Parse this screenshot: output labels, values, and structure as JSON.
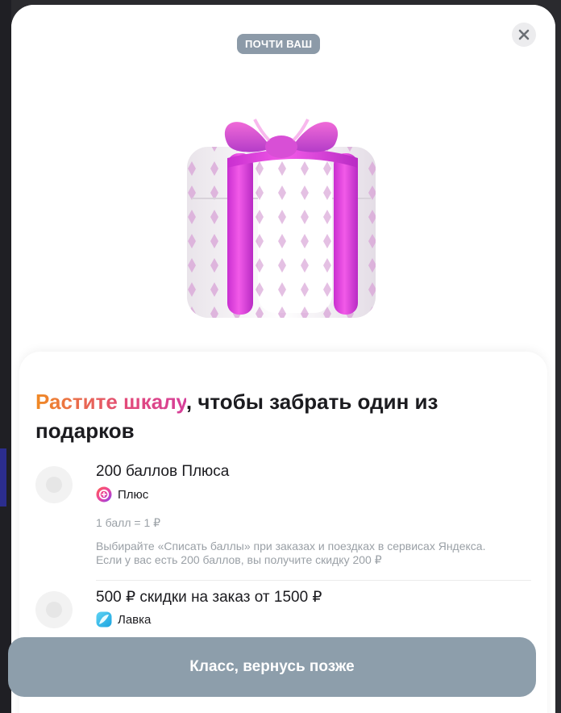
{
  "badge": "ПОЧТИ ВАШ",
  "icons": {
    "close": "close-icon",
    "gift": "gift-image",
    "plus": "plus-logo-icon",
    "lavka": "lavka-logo-icon"
  },
  "colors": {
    "badge_bg": "#8c9aa8",
    "accent_gradient_start": "#f08a24",
    "accent_gradient_end": "#d63f9a",
    "button_bg": "#8d9eab",
    "ribbon": "#e63be0"
  },
  "headline": {
    "accent": "Растите шкалу",
    "rest": ", чтобы забрать один из подарков"
  },
  "options": [
    {
      "title": "200 баллов Плюса",
      "brand": "Плюс",
      "rate": "1 балл = 1 ₽",
      "description": "Выбирайте «Списать баллы» при заказах и поездках в сервисах Яндекса. Если у вас есть 200 баллов, вы получите скидку 200 ₽"
    },
    {
      "title": "500 ₽ скидки на заказ от 1500 ₽",
      "brand": "Лавка"
    }
  ],
  "action_button": "Класс, вернусь позже"
}
